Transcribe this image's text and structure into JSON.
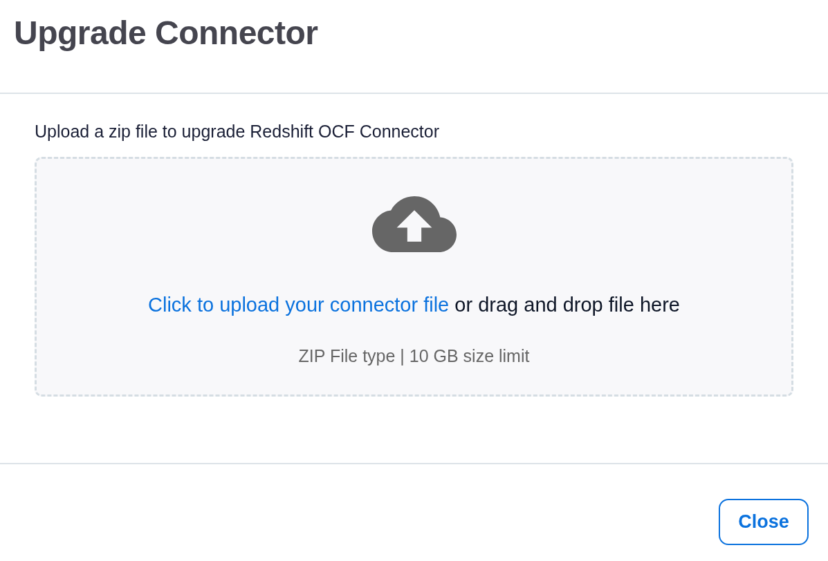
{
  "dialog": {
    "title": "Upgrade Connector"
  },
  "upload": {
    "label": "Upload a zip file to upgrade Redshift OCF Connector",
    "link": "Click to upload your connector file",
    "text": "or drag and drop file here",
    "hint": "ZIP File type | 10 GB size limit"
  },
  "footer": {
    "buttons": [
      {
        "label": "Close"
      }
    ]
  }
}
